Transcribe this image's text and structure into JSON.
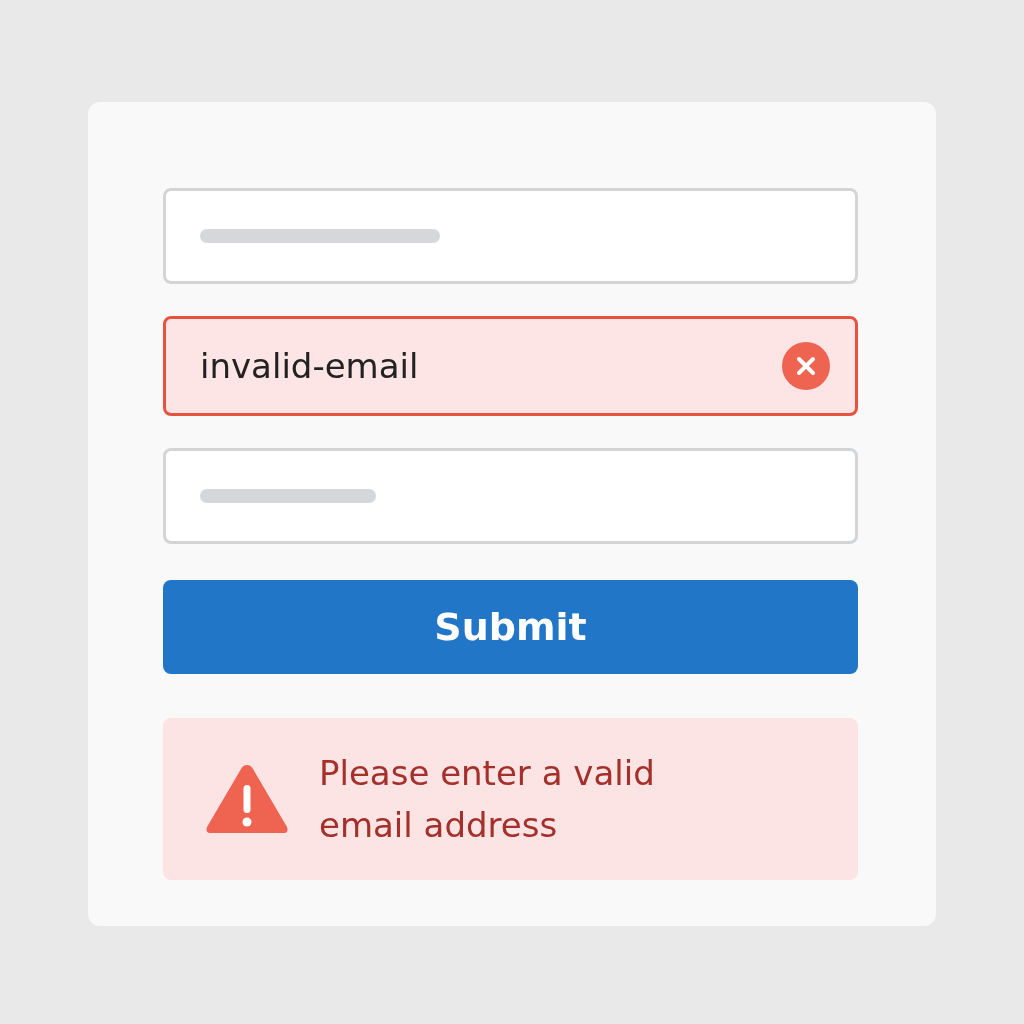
{
  "fields": [
    {
      "kind": "blank",
      "invalid": false
    },
    {
      "kind": "filled",
      "value": "invalid-email",
      "invalid": true
    },
    {
      "kind": "blank",
      "invalid": false
    }
  ],
  "submit": {
    "label": "Submit"
  },
  "alert": {
    "message": "Please enter a valid email address"
  }
}
